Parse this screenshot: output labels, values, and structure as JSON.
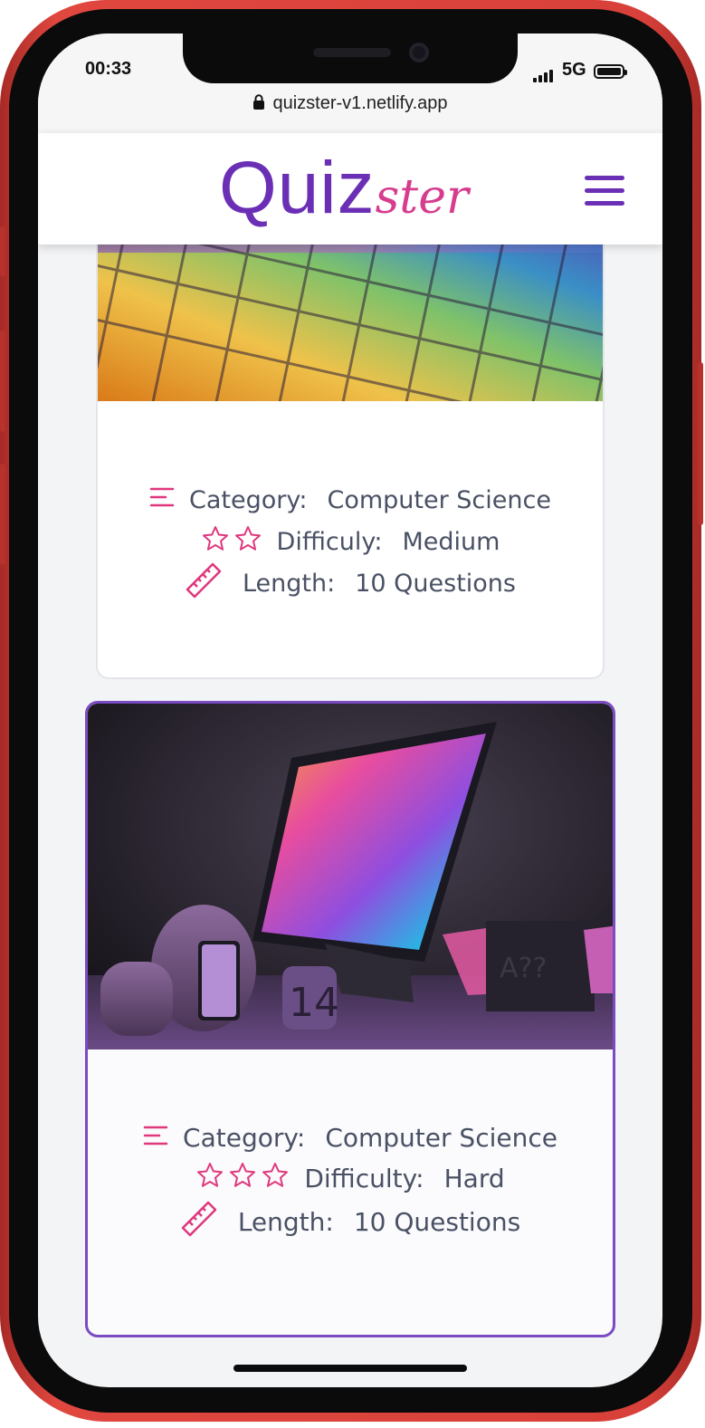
{
  "status_bar": {
    "time": "00:33",
    "network": "5G"
  },
  "browser": {
    "url": "quizster-v1.netlify.app"
  },
  "app": {
    "logo_main": "Quiz",
    "logo_accent": "ster",
    "brand_purple": "#6a2fb5",
    "brand_pink": "#d63d8e"
  },
  "quizzes": [
    {
      "image": "colorful-keyboard-photo",
      "category_label": "Category:",
      "category": "Computer Science",
      "difficulty_label": "Difficuly:",
      "difficulty": "Medium",
      "stars": 2,
      "length_label": "Length:",
      "length": "10 Questions",
      "selected": false
    },
    {
      "image": "apple-devices-photo",
      "category_label": "Category:",
      "category": "Computer Science",
      "difficulty_label": "Difficulty:",
      "difficulty": "Hard",
      "stars": 3,
      "length_label": "Length:",
      "length": "10 Questions",
      "selected": true
    }
  ],
  "icons": {
    "category": "list-align-icon",
    "difficulty": "star-icon",
    "length": "ruler-icon",
    "menu": "hamburger-menu-icon",
    "lock": "lock-icon"
  }
}
